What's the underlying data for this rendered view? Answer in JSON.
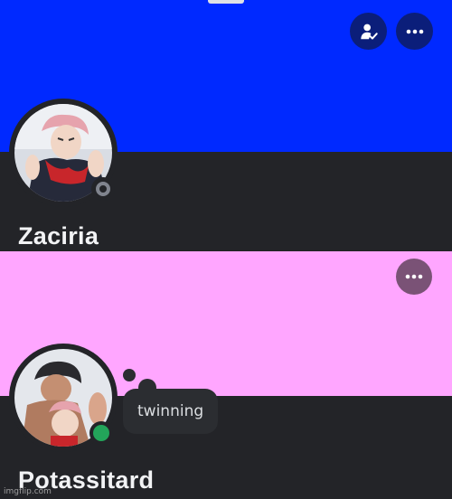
{
  "colors": {
    "card_bg": "#232428",
    "banner_1": "#0029ff",
    "banner_2": "#ffa6ff",
    "action_btn_1": "#0b1e7a",
    "action_btn_2": "#7a5276",
    "status_offline": "#80848e",
    "status_online": "#23a55a"
  },
  "icons": {
    "friend_action": "person-check-icon",
    "more": "more-horizontal-icon"
  },
  "profiles": [
    {
      "username": "Zaciria",
      "status": "offline"
    },
    {
      "username": "Potassitard",
      "status": "online",
      "custom_status": "twinning"
    }
  ],
  "watermark": "imgflip.com"
}
